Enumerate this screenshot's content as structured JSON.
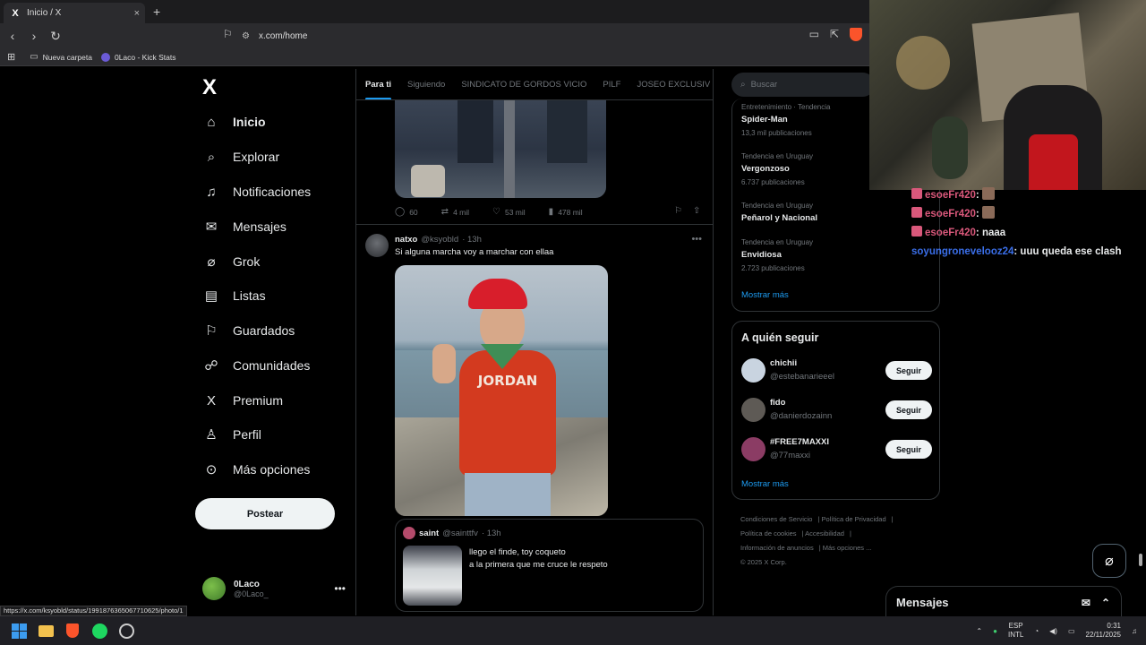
{
  "browser": {
    "tab_title": "Inicio / X",
    "tab_close": "×",
    "new_tab": "+",
    "url": "x.com/home",
    "bookmarks": [
      "Nueva carpeta",
      "0Laco - Kick Stats"
    ]
  },
  "nav": {
    "logo": "X",
    "items": [
      "Inicio",
      "Explorar",
      "Notificaciones",
      "Mensajes",
      "Grok",
      "Listas",
      "Guardados",
      "Comunidades",
      "Premium",
      "Perfil",
      "Más opciones"
    ],
    "icons": [
      "home-icon",
      "search-icon",
      "bell-icon",
      "mail-icon",
      "grok-icon",
      "list-icon",
      "bookmark-icon",
      "communities-icon",
      "x-premium-icon",
      "profile-icon",
      "more-circle-icon"
    ],
    "post_label": "Postear",
    "account": {
      "name": "0Laco",
      "handle": "@0Laco_"
    }
  },
  "timeline": {
    "tabs": [
      "Para ti",
      "Siguiendo",
      "SINDICATO DE GORDOS VICIO",
      "PILF",
      "JOSEO EXCLUSIV"
    ],
    "prev_tweet_actions": {
      "replies": "60",
      "reposts": "4 mil",
      "likes": "53 mil",
      "views": "478 mil"
    },
    "tweet": {
      "name": "natxo",
      "handle": "@ksyobld",
      "time": "· 13h",
      "text": "Si alguna marcha voy a marchar con ellaa",
      "photo_text": "JORDAN",
      "quote": {
        "name": "saint",
        "handle": "@sainttfv",
        "time": "· 13h",
        "line1": "llego el finde, toy coqueto",
        "line2": "a la primera que me cruce le respeto"
      }
    }
  },
  "sidebar": {
    "search_placeholder": "Buscar",
    "trends": [
      {
        "meta": "Entretenimiento · Tendencia",
        "name": "Spider-Man",
        "count": "13,3 mil publicaciones"
      },
      {
        "meta": "Tendencia en Uruguay",
        "name": "Vergonzoso",
        "count": "6.737 publicaciones"
      },
      {
        "meta": "Tendencia en Uruguay",
        "name": "Peñarol y Nacional",
        "count": ""
      },
      {
        "meta": "Tendencia en Uruguay",
        "name": "Envidiosa",
        "count": "2.723 publicaciones"
      }
    ],
    "trends_more": "Mostrar más",
    "who_title": "A quién seguir",
    "who": [
      {
        "name": "chichii",
        "handle": "@estebanarieeel",
        "btn": "Seguir",
        "color": "#c9d4e0"
      },
      {
        "name": "fido",
        "handle": "@danierdozainn",
        "btn": "Seguir",
        "color": "#5e5a55"
      },
      {
        "name": "#FREE7MAXXI",
        "handle": "@77maxxi",
        "btn": "Seguir",
        "color": "#8b3c64"
      }
    ],
    "who_more": "Mostrar más",
    "footer": [
      "Condiciones de Servicio",
      "Política de Privacidad",
      "Política de cookies",
      "Accesibilidad",
      "Información de anuncios",
      "Más opciones ...",
      "© 2025 X Corp."
    ]
  },
  "chat": {
    "line1_user": "esoeFr420",
    "line2_user": "esoeFr420",
    "line3_user": "esoeFr420",
    "line3_msg": " naaa",
    "line4_user": "soyungronevelooz24",
    "line4_msg": " uuu queda ese clash",
    "colon": ":"
  },
  "messages_dock": {
    "title": "Mensajes"
  },
  "status_url": "https://x.com/ksyobld/status/1991876365067710625/photo/1",
  "taskbar": {
    "lang1": "ESP",
    "lang2": "INTL",
    "time": "0:31",
    "date": "22/11/2025"
  }
}
